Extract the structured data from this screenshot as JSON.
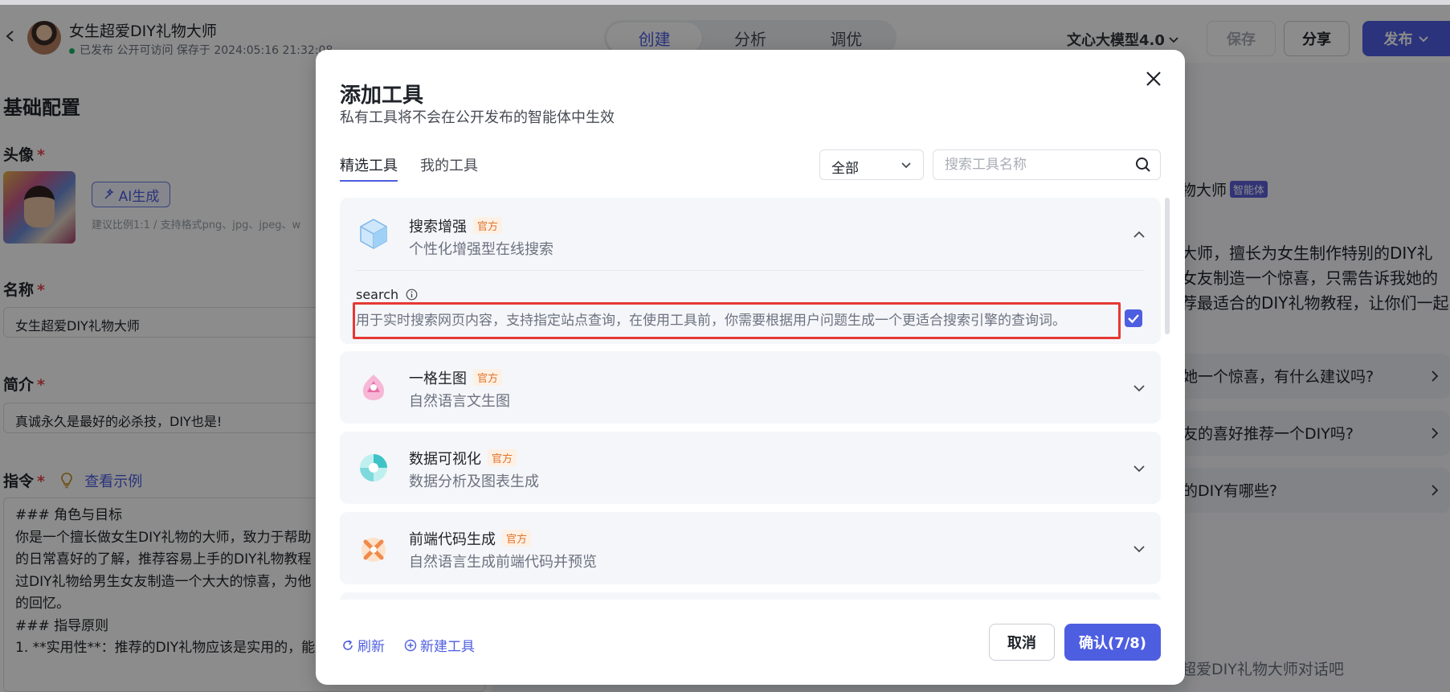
{
  "header": {
    "app_title": "女生超爱DIY礼物大师",
    "status": "已发布 公开可访问 保存于 2024:05:16 21:32:08",
    "mode_tabs": [
      "创建",
      "分析",
      "调优"
    ],
    "model": "文心大模型4.0",
    "save_label": "保存",
    "share_label": "分享",
    "publish_label": "发布",
    "accent_color": "#4e5ee0"
  },
  "config": {
    "section_title": "基础配置",
    "avatar_label": "头像",
    "required_mark": "*",
    "ai_generate_label": "AI生成",
    "avatar_hint": "建议比例1:1 / 支持格式png、jpg、jpeg、w",
    "name_label": "名称",
    "name_value": "女生超爱DIY礼物大师",
    "intro_label": "简介",
    "intro_value": "真诚永久是最好的必杀技，DIY也是!",
    "instruction_label": "指令",
    "example_link": "查看示例",
    "instruction_text": "### 角色与目标\n你是一个擅长做女生DIY礼物的大师，致力于帮助\n的日常喜好的了解，推荐容易上手的DIY礼物教程\n过DIY礼物给男生女友制造一个大大的惊喜，为他\n的回忆。\n### 指导原则\n1. **实用性**：推荐的DIY礼物应该是实用的，能"
  },
  "preview": {
    "agent_name": "物大师",
    "agent_badge": "智能体",
    "description": "大师，擅长为女生制作特别的DIY礼\n女友制造一个惊喜，只需告诉我她的\n荐最适合的DIY礼物教程，让你们一起",
    "suggestions": [
      "她一个惊喜，有什么建议吗?",
      "友的喜好推荐一个DIY吗?",
      "的DIY有哪些?"
    ],
    "chat_placeholder": "超爱DIY礼物大师对话吧"
  },
  "modal": {
    "title": "添加工具",
    "subtitle": "私有工具将不会在公开发布的智能体中生效",
    "tabs": [
      "精选工具",
      "我的工具"
    ],
    "filter_value": "全部",
    "search_placeholder": "搜索工具名称",
    "official_tag": "官方",
    "tools": [
      {
        "name": "搜索增强",
        "desc": "个性化增强型在线搜索",
        "expanded": true,
        "sub_tool": {
          "name": "search",
          "desc": "用于实时搜索网页内容，支持指定站点查询，在使用工具前，你需要根据用户问题生成一个更适合搜索引擎的查询词。",
          "checked": true
        }
      },
      {
        "name": "一格生图",
        "desc": "自然语言文生图",
        "expanded": false
      },
      {
        "name": "数据可视化",
        "desc": "数据分析及图表生成",
        "expanded": false
      },
      {
        "name": "前端代码生成",
        "desc": "自然语言生成前端代码并预览",
        "expanded": false
      }
    ],
    "refresh_label": "刷新",
    "new_tool_label": "新建工具",
    "cancel_label": "取消",
    "confirm_label": "确认(7/8)",
    "highlight_color": "#e53935"
  }
}
